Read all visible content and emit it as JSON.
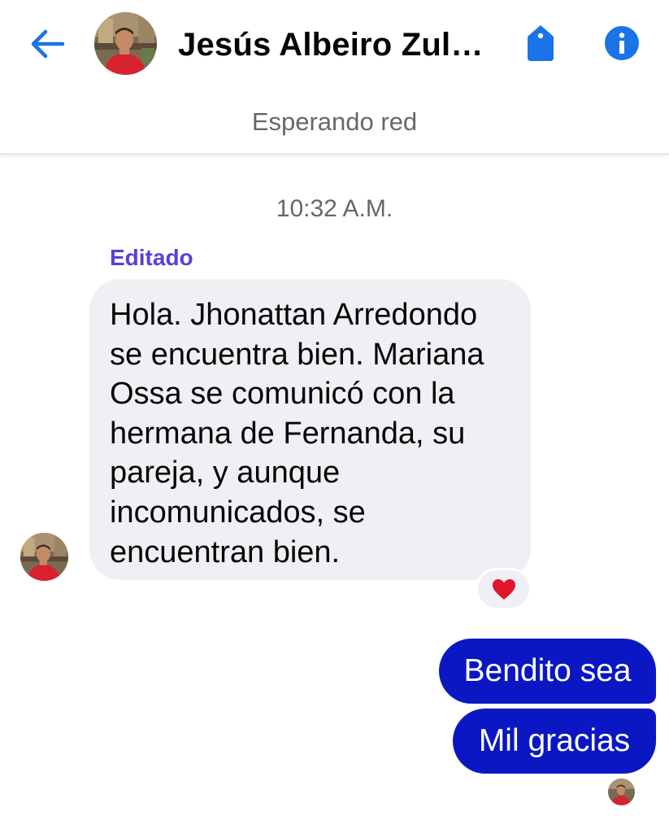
{
  "header": {
    "back_icon": "arrow-left-icon",
    "contact_name": "Jesús Albeiro Zulu...",
    "tag_icon": "tag-icon",
    "info_icon": "info-icon",
    "status": "Esperando red"
  },
  "conversation": {
    "timestamp": "10:32 A.M.",
    "incoming": {
      "edited_label": "Editado",
      "lines": [
        "Hola. Jhonattan Arredondo",
        "se encuentra bien. Mariana",
        "Ossa se comunicó con la",
        "hermana de Fernanda, su",
        "pareja, y aunque",
        "incomunicados, se",
        "encuentran bien."
      ],
      "reaction": "❤"
    },
    "outgoing": [
      {
        "text": "Bendito sea"
      },
      {
        "text": "Mil gracias"
      }
    ]
  },
  "colors": {
    "accent_blue": "#1a73e8",
    "outgoing_bubble": "#0a17c2",
    "incoming_bubble": "#f0f0f4",
    "edited_label": "#5b3fd8",
    "reaction_heart": "#e0162b"
  }
}
